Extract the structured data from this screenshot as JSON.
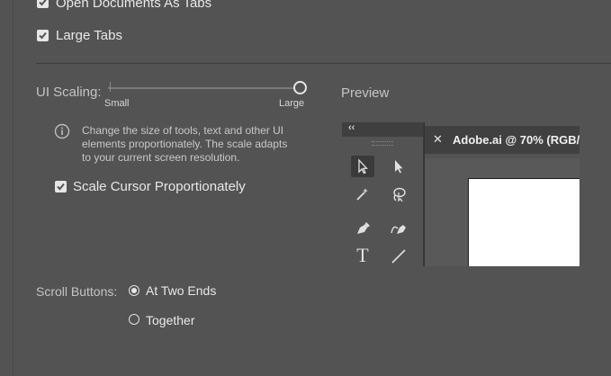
{
  "checkboxes": {
    "open_documents_as_tabs": "Open Documents As Tabs",
    "large_tabs": "Large Tabs",
    "scale_cursor": "Scale Cursor Proportionately"
  },
  "ui_scaling": {
    "label": "UI Scaling:",
    "min_label": "Small",
    "max_label": "Large",
    "value_fraction": 1.0,
    "info_text_line1": "Change the size of tools, text and other UI",
    "info_text_line2": "elements proportionately. The scale adapts",
    "info_text_line3": "to your current screen resolution."
  },
  "preview": {
    "label": "Preview",
    "collapse_glyph": "‹‹",
    "doc_tab_title": "Adobe.ai @ 70% (RGB/",
    "close_glyph": "✕"
  },
  "scroll_buttons": {
    "label": "Scroll Buttons:",
    "options": [
      "At Two Ends",
      "Together"
    ],
    "selected": "At Two Ends"
  },
  "colors": {
    "background": "#535353",
    "text": "#e6e6e6"
  }
}
